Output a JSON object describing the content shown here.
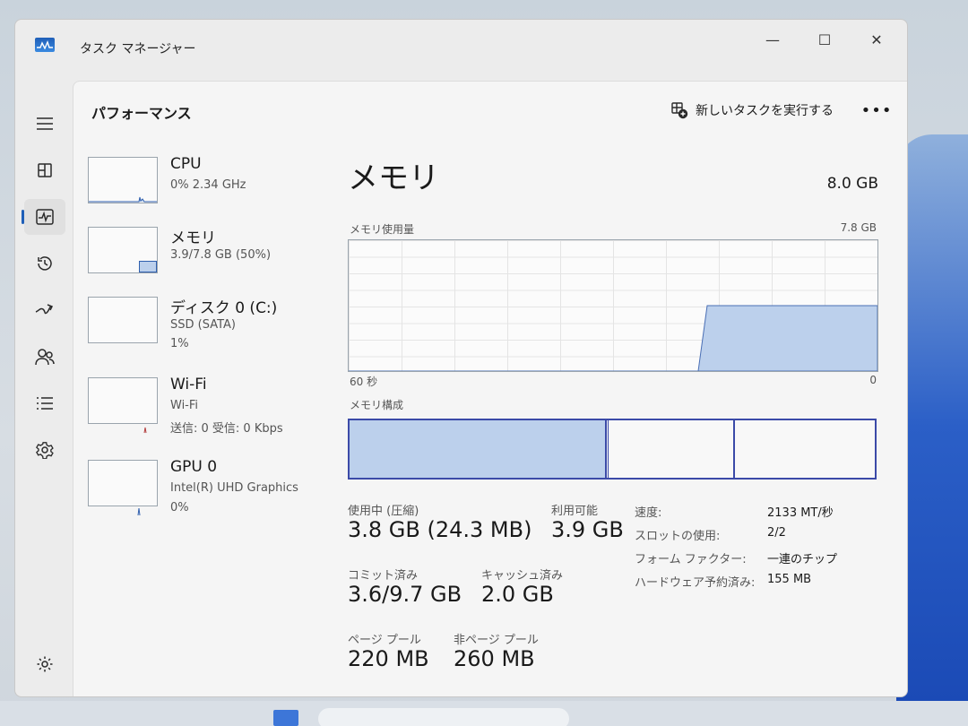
{
  "window": {
    "title": "タスク マネージャー",
    "minimize_glyph": "—",
    "maximize_glyph": "☐",
    "close_glyph": "✕"
  },
  "nav": [
    {
      "name": "hamburger-menu-icon"
    },
    {
      "name": "processes-icon"
    },
    {
      "name": "performance-icon",
      "active": true
    },
    {
      "name": "app-history-icon"
    },
    {
      "name": "startup-apps-icon"
    },
    {
      "name": "users-icon"
    },
    {
      "name": "details-icon"
    },
    {
      "name": "services-icon"
    }
  ],
  "header": {
    "page_title": "パフォーマンス",
    "run_task_label": "新しいタスクを実行する",
    "more_glyph": "•••"
  },
  "devices": [
    {
      "name": "CPU",
      "sub": [
        "0%  2.34 GHz"
      ]
    },
    {
      "name": "メモリ",
      "sub": [
        "3.9/7.8 GB (50%)"
      ],
      "fill": 0.5
    },
    {
      "name": "ディスク 0 (C:)",
      "sub": [
        "SSD (SATA)",
        "1%"
      ]
    },
    {
      "name": "Wi-Fi",
      "sub": [
        "Wi-Fi",
        "送信: 0 受信: 0 Kbps"
      ]
    },
    {
      "name": "GPU 0",
      "sub": [
        "Intel(R) UHD Graphics",
        "0%"
      ]
    }
  ],
  "detail": {
    "title": "メモリ",
    "capacity": "8.0 GB",
    "usage_label": "メモリ使用量",
    "usage_max": "7.8 GB",
    "axis_left": "60 秒",
    "axis_right": "0",
    "composition_label": "メモリ構成",
    "composition": {
      "used": 0.49,
      "modified": 0.004,
      "standby": 0.24,
      "free": 0.266
    },
    "usage_history": [
      0,
      0,
      0,
      0,
      0,
      0,
      0,
      0,
      0,
      0,
      0,
      0,
      0,
      0,
      0,
      0,
      0,
      0,
      0,
      0,
      0,
      0,
      0,
      0,
      0,
      0,
      0,
      0,
      0,
      0,
      0,
      0,
      0,
      0,
      0,
      0,
      0,
      0,
      0,
      0,
      0.5,
      0.5,
      0.5,
      0.5,
      0.5,
      0.5,
      0.5,
      0.5,
      0.5,
      0.5,
      0.5,
      0.5,
      0.5,
      0.5,
      0.5,
      0.5,
      0.5,
      0.5,
      0.5,
      0.5
    ],
    "stats": {
      "in_use_label": "使用中 (圧縮)",
      "in_use_value": "3.8 GB (24.3 MB)",
      "available_label": "利用可能",
      "available_value": "3.9 GB",
      "committed_label": "コミット済み",
      "committed_value": "3.6/9.7 GB",
      "cached_label": "キャッシュ済み",
      "cached_value": "2.0 GB",
      "paged_label": "ページ プール",
      "paged_value": "220 MB",
      "nonpaged_label": "非ページ プール",
      "nonpaged_value": "260 MB"
    },
    "props": [
      {
        "key": "速度:",
        "value": "2133 MT/秒"
      },
      {
        "key": "スロットの使用:",
        "value": "2/2"
      },
      {
        "key": "フォーム ファクター:",
        "value": "一連のチップ"
      },
      {
        "key": "ハードウェア予約済み:",
        "value": "155 MB"
      }
    ]
  }
}
